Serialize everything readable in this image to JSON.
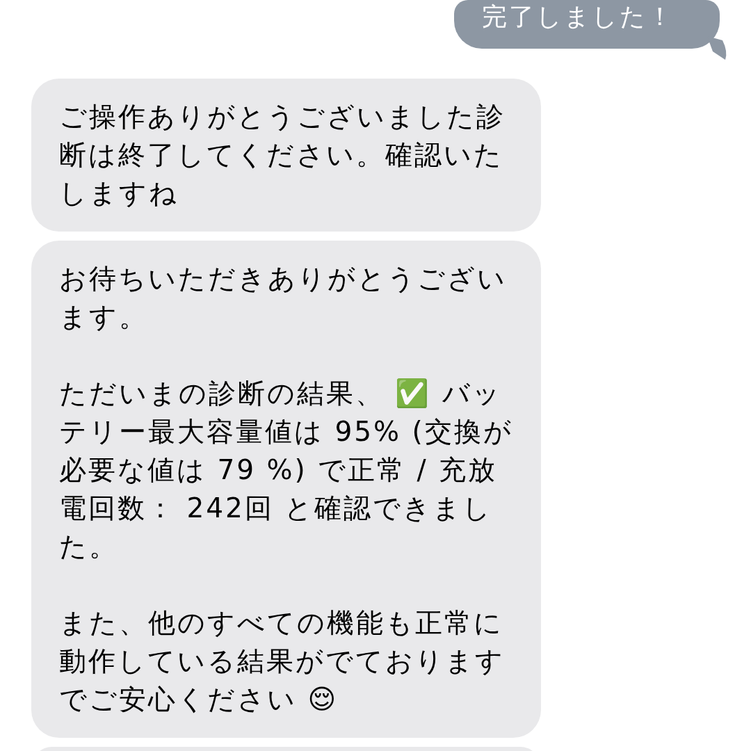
{
  "messages": [
    {
      "kind": "sent",
      "paragraphs": [
        "完了しました！"
      ]
    },
    {
      "kind": "received",
      "paragraphs": [
        "ご操作ありがとうございました診断は終了してください。確認いたしますね"
      ]
    },
    {
      "kind": "received",
      "paragraphs": [
        "お待ちいただきありがとうございます。",
        "ただいまの診断の結果、 ✅ バッテリー最大容量値は 95% (交換が必要な値は 79 %) で正常 / 充放電回数： 242回 と確認できました。",
        "また、他のすべての機能も正常に動作している結果がでておりますでご安心ください 😌"
      ]
    },
    {
      "kind": "received"
    }
  ]
}
